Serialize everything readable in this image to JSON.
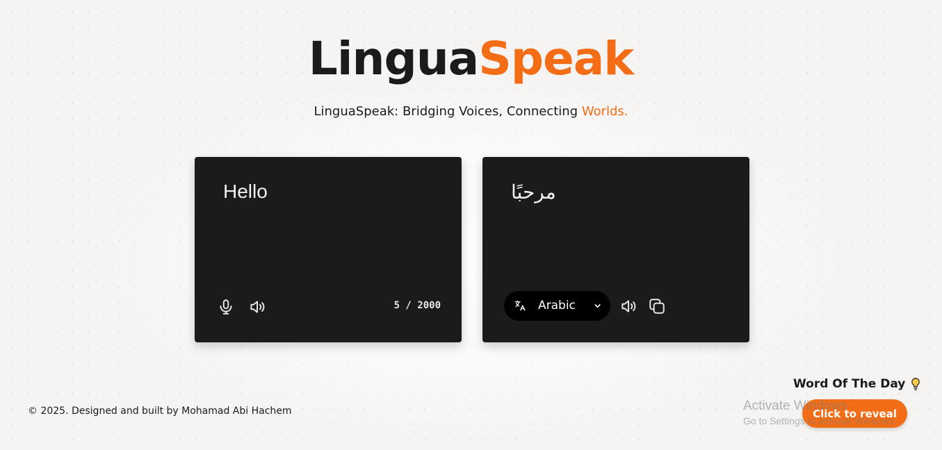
{
  "brand": {
    "part1": "Lingua",
    "part2": "Speak"
  },
  "tagline": {
    "main": "LinguaSpeak: Bridging Voices, Connecting ",
    "accent": "Worlds."
  },
  "source_panel": {
    "text": "Hello",
    "char_count": "5 / 2000",
    "icons": [
      "microphone-icon",
      "speaker-icon"
    ]
  },
  "target_panel": {
    "text": "مرحبًا",
    "language": "Arabic",
    "icons": [
      "translate-icon",
      "chevron-down-icon",
      "speaker-icon",
      "copy-icon"
    ]
  },
  "footer": {
    "text": "© 2025. Designed and built by Mohamad Abi Hachem"
  },
  "word_of_the_day": {
    "title": "Word Of The Day",
    "button_label": "Click to reveal",
    "icon": "lightbulb-icon"
  },
  "os_watermark": {
    "line1": "Activate Windows",
    "line2": "Go to Settings to activate Windows."
  },
  "colors": {
    "accent": "#f36d16",
    "panel": "#1b1b1b",
    "background": "#f5f4f3"
  }
}
